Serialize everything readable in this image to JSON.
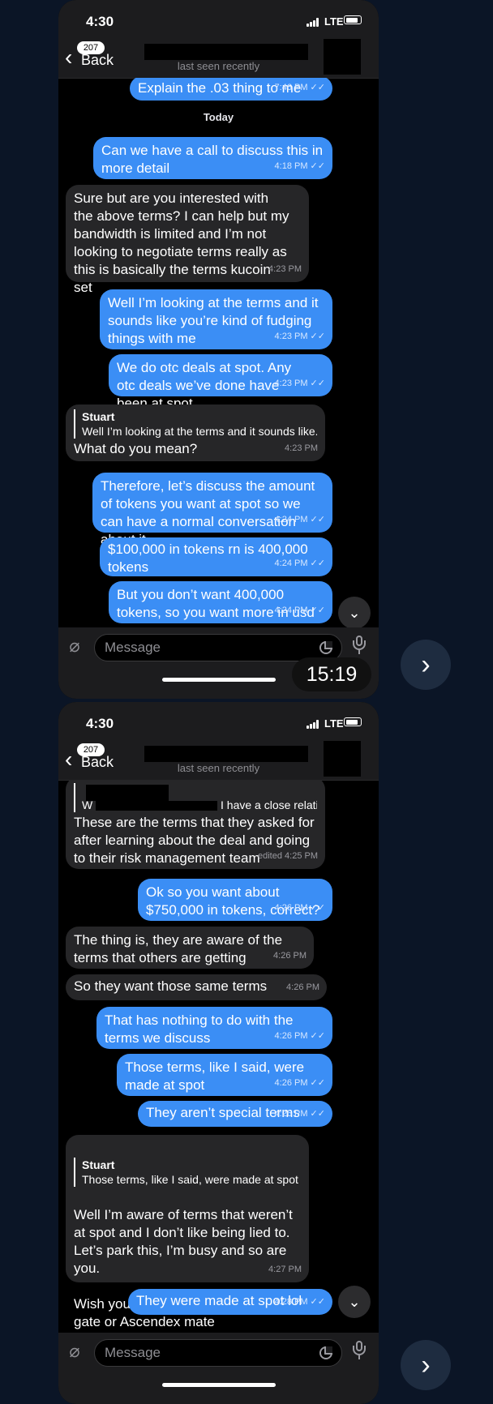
{
  "phone1": {
    "status_time": "4:30",
    "network": "LTE",
    "header": {
      "back_label": "Back",
      "back_badge": "207",
      "status": "last seen recently"
    },
    "day_separator": "Today",
    "messages": [
      {
        "dir": "out",
        "text": "Explain the .03 thing to me",
        "time": "7:46 PM"
      },
      {
        "dir": "out",
        "text": "Can we have a call to discuss this in more detail",
        "time": "4:18 PM"
      },
      {
        "dir": "in",
        "text": "Sure but are you interested with the above terms? I can help but my bandwidth is limited and I’m not looking to negotiate terms really as this is basically the terms kucoin set",
        "time": "4:23 PM"
      },
      {
        "dir": "out",
        "text": "Well I’m looking at the terms and it sounds like you’re kind of fudging things with me",
        "time": "4:23 PM"
      },
      {
        "dir": "out",
        "text": "We do otc deals at spot. Any otc deals we’ve done have been at spot",
        "time": "4:23 PM"
      },
      {
        "dir": "in",
        "reply_author": "Stuart",
        "reply_text": "Well I’m looking at the terms and it sounds like...",
        "text": "What do you mean?",
        "time": "4:23 PM"
      },
      {
        "dir": "out",
        "text": "Therefore, let’s discuss the amount of tokens you want at spot so we can have a normal conversation about it",
        "time": "4:24 PM"
      },
      {
        "dir": "out",
        "text": "$100,000 in tokens rn is 400,000 tokens",
        "time": "4:24 PM"
      },
      {
        "dir": "out",
        "text": "But you don’t want 400,000 tokens, so you want more in usd",
        "time": "4:24 PM"
      }
    ],
    "input_placeholder": "Message",
    "timer": "15:19"
  },
  "phone2": {
    "status_time": "4:30",
    "network": "LTE",
    "header": {
      "back_label": "Back",
      "back_badge": "207",
      "status": "last seen recently"
    },
    "messages": [
      {
        "dir": "in",
        "reply_author": "W",
        "reply_text": "I have a close relations...",
        "text": "These are the terms that they asked for after learning about the deal and going to their risk management team",
        "time": "edited 4:25 PM"
      },
      {
        "dir": "out",
        "text": "Ok so you want about $750,000 in tokens, correct?",
        "time": "4:26 PM"
      },
      {
        "dir": "in",
        "text": "The thing is, they are aware of the terms that others are getting",
        "time": "4:26 PM"
      },
      {
        "dir": "in",
        "text": "So they want those same terms",
        "time": "4:26 PM"
      },
      {
        "dir": "out",
        "text": "That has nothing to do with the terms we discuss",
        "time": "4:26 PM"
      },
      {
        "dir": "out",
        "text": "Those terms, like I said, were made at spot",
        "time": "4:26 PM"
      },
      {
        "dir": "out",
        "text": "They aren’t special terms",
        "time": "4:26 PM"
      },
      {
        "dir": "in",
        "reply_author": "Stuart",
        "reply_text": "Those terms, like I said, were made at spot",
        "text": "Well I’m aware of terms that weren’t at spot and I don’t like being lied to. Let’s park this, I’m busy and so are you.\n\nWish you and Lamden the best on gate or Ascendex mate",
        "time": "4:27 PM"
      },
      {
        "dir": "out",
        "text": "They were made at spot lol",
        "time": "4:28 PM"
      }
    ],
    "input_placeholder": "Message"
  },
  "colors": {
    "outgoing": "#3b8ef5",
    "incoming": "#262628",
    "background": "#0b1526"
  },
  "icons": [
    "back-chevron-icon",
    "attach-icon",
    "sticker-icon",
    "mic-icon",
    "chevron-down-icon",
    "chevron-right-icon"
  ]
}
